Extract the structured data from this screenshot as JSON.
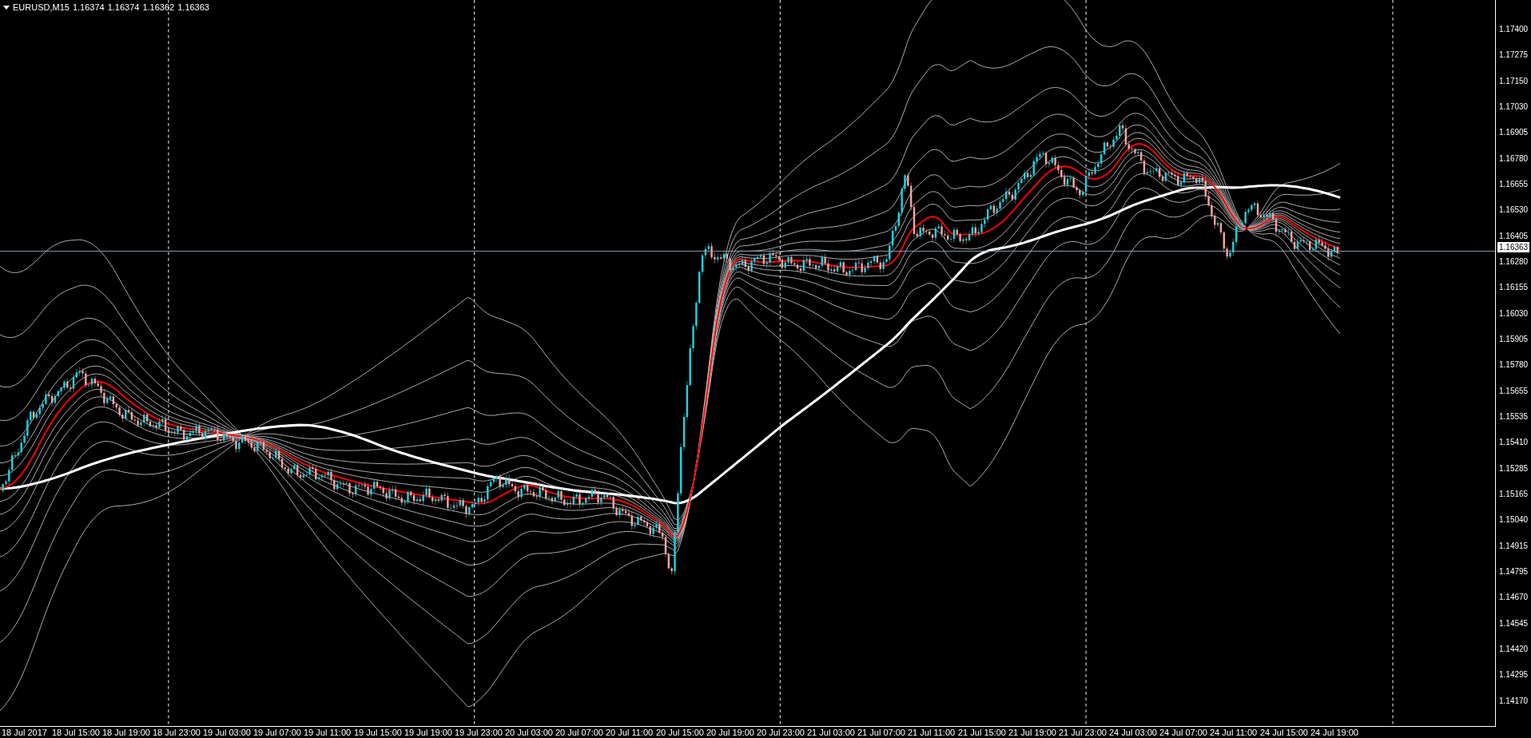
{
  "title": {
    "symbol": "EURUSD,M15",
    "quotes": [
      "1.16374",
      "1.16374",
      "1.16362",
      "1.16363"
    ]
  },
  "price_axis": {
    "labels": [
      "1.17400",
      "1.17275",
      "1.17150",
      "1.17030",
      "1.16905",
      "1.16780",
      "1.16655",
      "1.16530",
      "1.16405",
      "1.16280",
      "1.16155",
      "1.16030",
      "1.15905",
      "1.15780",
      "1.15655",
      "1.15535",
      "1.15410",
      "1.15285",
      "1.15165",
      "1.15040",
      "1.14915",
      "1.14795",
      "1.14670",
      "1.14545",
      "1.14420",
      "1.14295",
      "1.14170"
    ],
    "current_price": "1.16363"
  },
  "time_axis": {
    "labels": [
      "18 Jul 2017",
      "18 Jul 15:00",
      "18 Jul 19:00",
      "18 Jul 23:00",
      "19 Jul 03:00",
      "19 Jul 07:00",
      "19 Jul 11:00",
      "19 Jul 15:00",
      "19 Jul 19:00",
      "19 Jul 23:00",
      "20 Jul 03:00",
      "20 Jul 07:00",
      "20 Jul 11:00",
      "20 Jul 15:00",
      "20 Jul 19:00",
      "20 Jul 23:00",
      "21 Jul 03:00",
      "21 Jul 07:00",
      "21 Jul 11:00",
      "21 Jul 15:00",
      "21 Jul 19:00",
      "21 Jul 23:00",
      "24 Jul 03:00",
      "24 Jul 07:00",
      "24 Jul 11:00",
      "24 Jul 15:00",
      "24 Jul 19:00"
    ]
  }
}
